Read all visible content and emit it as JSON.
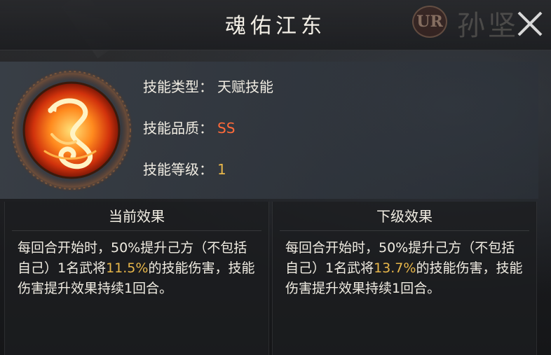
{
  "header": {
    "title": "魂佑江东",
    "bg_badge": "UR",
    "bg_name": "孙坚"
  },
  "skill_info": {
    "type_label": "技能类型：",
    "type_value": "天赋技能",
    "quality_label": "技能品质：",
    "quality_value": "SS",
    "level_label": "技能等级：",
    "level_value": "1"
  },
  "current_effect": {
    "header": "当前效果",
    "text_before": "每回合开始时，50%提升己方（不包括自己）1名武将",
    "highlight": "11.5%",
    "text_after": "的技能伤害，技能伤害提升效果持续1回合。"
  },
  "next_effect": {
    "header": "下级效果",
    "text_before": "每回合开始时，50%提升己方（不包括自己）1名武将",
    "highlight": "13.7%",
    "text_after": "的技能伤害，技能伤害提升效果持续1回合。"
  },
  "colors": {
    "quality": "#ff6a3a",
    "highlight": "#e8b74a",
    "panel": "#3a4048"
  },
  "icons": {
    "close": "close-icon",
    "emblem": "dragon-emblem-icon"
  }
}
